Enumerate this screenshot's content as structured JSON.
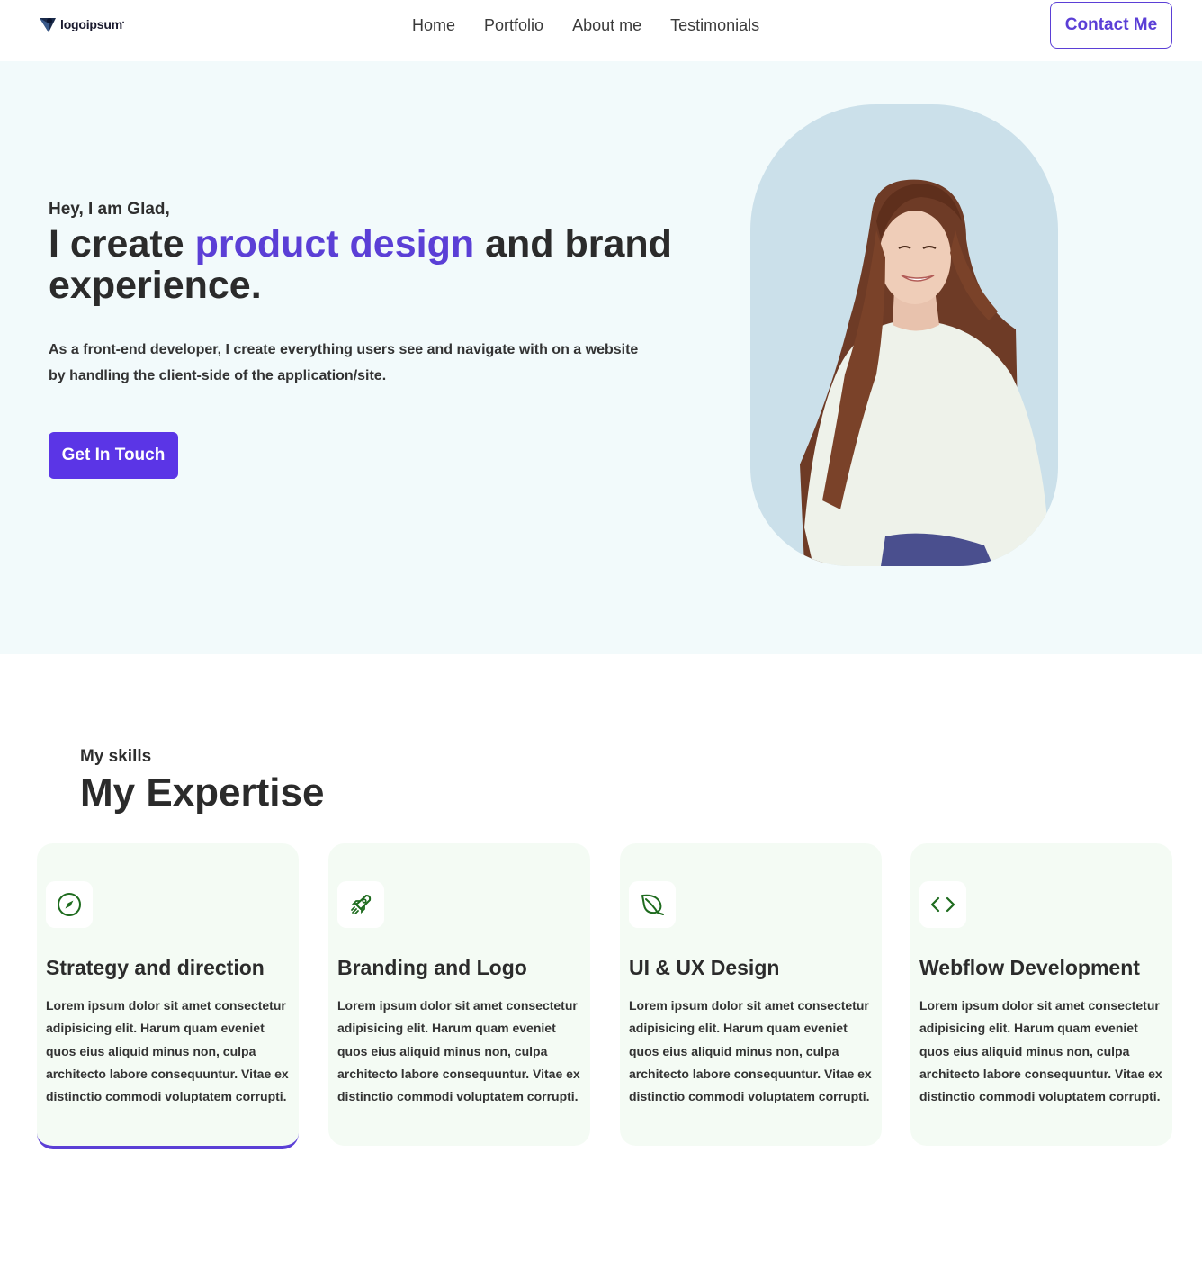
{
  "nav": {
    "logo_text": "logoipsum",
    "logo_mark": "•",
    "links": [
      "Home",
      "Portfolio",
      "About me",
      "Testimonials"
    ],
    "contact_label": "Contact Me"
  },
  "hero": {
    "greeting": "Hey, I am Glad,",
    "title_part1": "I create ",
    "title_accent": "product design",
    "title_part2": " and brand experience.",
    "description": "As a front-end developer, I create everything users see and navigate with on a website by handling the client-side of the application/site.",
    "cta_label": "Get In Touch"
  },
  "skills": {
    "subtitle": "My skills",
    "title": "My Expertise",
    "cards": [
      {
        "icon": "compass-icon",
        "title": "Strategy and direction",
        "text": "Lorem ipsum dolor sit amet consectetur adipisicing elit. Harum quam eveniet quos eius aliquid minus non, culpa architecto labore consequuntur. Vitae ex distinctio commodi voluptatem corrupti."
      },
      {
        "icon": "rocket-icon",
        "title": "Branding and Logo",
        "text": "Lorem ipsum dolor sit amet consectetur adipisicing elit. Harum quam eveniet quos eius aliquid minus non, culpa architecto labore consequuntur. Vitae ex distinctio commodi voluptatem corrupti."
      },
      {
        "icon": "leaf-icon",
        "title": "UI & UX Design",
        "text": "Lorem ipsum dolor sit amet consectetur adipisicing elit. Harum quam eveniet quos eius aliquid minus non, culpa architecto labore consequuntur. Vitae ex distinctio commodi voluptatem corrupti."
      },
      {
        "icon": "code-icon",
        "title": "Webflow Development",
        "text": "Lorem ipsum dolor sit amet consectetur adipisicing elit. Harum quam eveniet quos eius aliquid minus non, culpa architecto labore consequuntur. Vitae ex distinctio commodi voluptatem corrupti."
      }
    ]
  },
  "colors": {
    "accent": "#5b3fd6",
    "hero_bg": "#f2fafb",
    "card_bg": "#f4fbf4",
    "icon_green": "#1e6b1e"
  }
}
